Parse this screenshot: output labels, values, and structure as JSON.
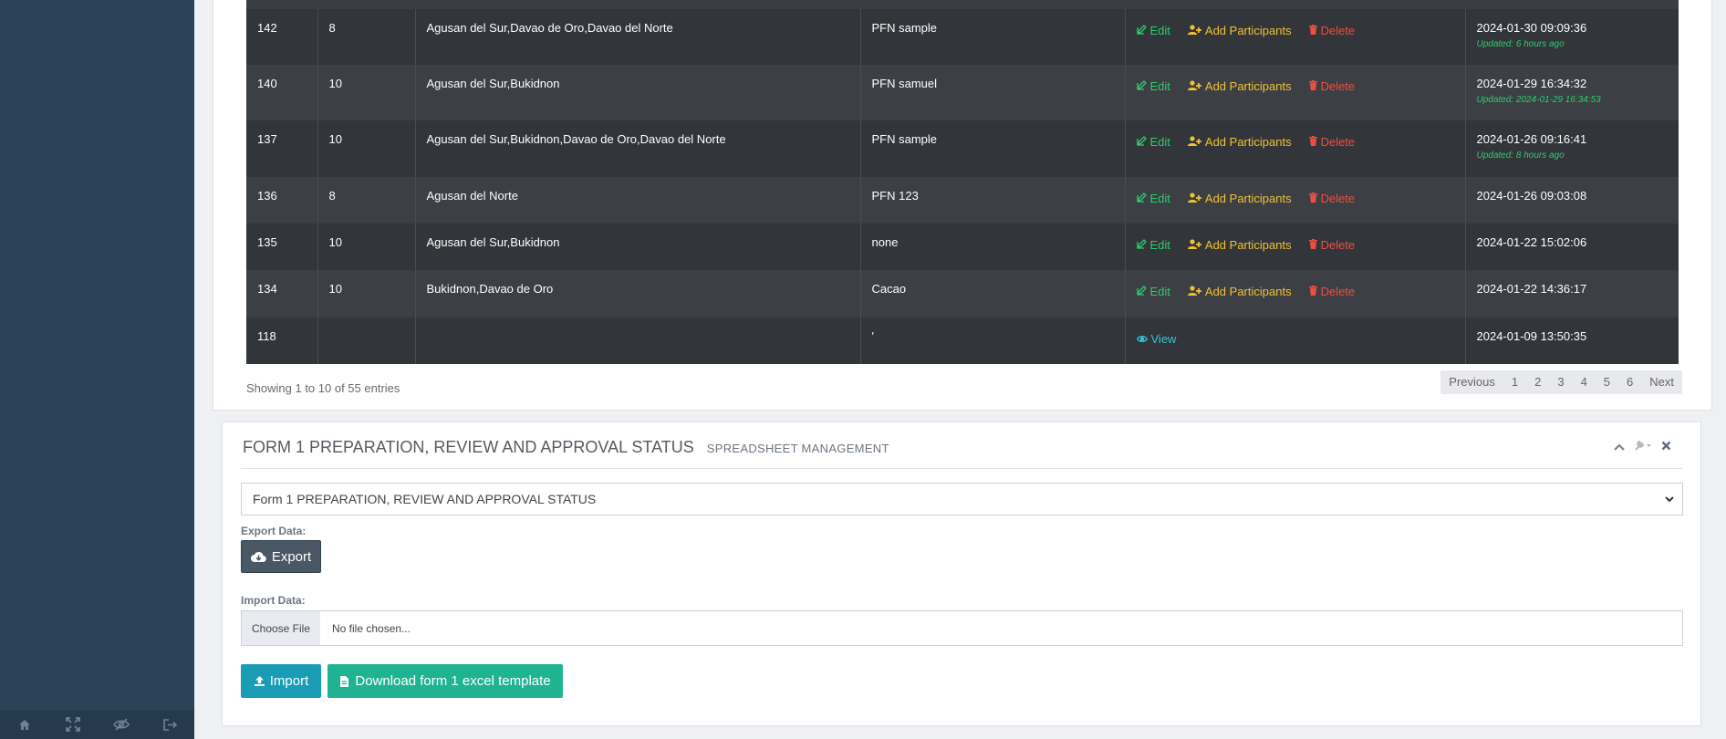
{
  "sidebar": {
    "footer_buttons": [
      {
        "icon": "home-icon"
      },
      {
        "icon": "fullscreen-icon"
      },
      {
        "icon": "eye-slash-icon"
      },
      {
        "icon": "sign-out-icon"
      }
    ]
  },
  "table": {
    "rows": [
      {
        "id": "142",
        "num": "8",
        "provinces": "Agusan del Sur,Davao de Oro,Davao del Norte",
        "title": "PFN sample",
        "created": "2024-01-30 09:09:36",
        "updated": "Updated: 6 hours ago",
        "actions": "full"
      },
      {
        "id": "140",
        "num": "10",
        "provinces": "Agusan del Sur,Bukidnon",
        "title": "PFN samuel",
        "created": "2024-01-29 16:34:32",
        "updated": "Updated: 2024-01-29 16:34:53",
        "actions": "full"
      },
      {
        "id": "137",
        "num": "10",
        "provinces": "Agusan del Sur,Bukidnon,Davao de Oro,Davao del Norte",
        "title": "PFN sample",
        "created": "2024-01-26 09:16:41",
        "updated": "Updated: 8 hours ago",
        "actions": "full"
      },
      {
        "id": "136",
        "num": "8",
        "provinces": "Agusan del Norte",
        "title": "PFN 123",
        "created": "2024-01-26 09:03:08",
        "updated": "",
        "actions": "full"
      },
      {
        "id": "135",
        "num": "10",
        "provinces": "Agusan del Sur,Bukidnon",
        "title": "none",
        "created": "2024-01-22 15:02:06",
        "updated": "",
        "actions": "full"
      },
      {
        "id": "134",
        "num": "10",
        "provinces": "Bukidnon,Davao de Oro",
        "title": "Cacao",
        "created": "2024-01-22 14:36:17",
        "updated": "",
        "actions": "full"
      },
      {
        "id": "118",
        "num": "",
        "provinces": "",
        "title": "'",
        "created": "2024-01-09 13:50:35",
        "updated": "",
        "actions": "view"
      }
    ],
    "actions": {
      "edit": "Edit",
      "add": "Add Participants",
      "delete": "Delete",
      "view": "View"
    },
    "info": "Showing 1 to 10 of 55 entries",
    "pagination": [
      "Previous",
      "1",
      "2",
      "3",
      "4",
      "5",
      "6",
      "Next"
    ]
  },
  "form_panel": {
    "title": "FORM 1 PREPARATION, REVIEW AND APPROVAL STATUS",
    "subtitle": "SPREADSHEET MANAGEMENT",
    "select_value": "Form 1 PREPARATION, REVIEW AND APPROVAL STATUS",
    "export_label": "Export Data:",
    "export_button": "Export",
    "import_label": "Import Data:",
    "choose_file": "Choose File",
    "no_file": "No file chosen...",
    "import_button": "Import",
    "download_button": "Download form 1 excel template"
  },
  "colors": {
    "sidebar": "#2b4259",
    "edit": "#2ecc71",
    "add": "#f1c232",
    "delete": "#ec4f3f",
    "view": "#35c4d6",
    "import": "#1b9cb5",
    "download": "#1fb391"
  }
}
